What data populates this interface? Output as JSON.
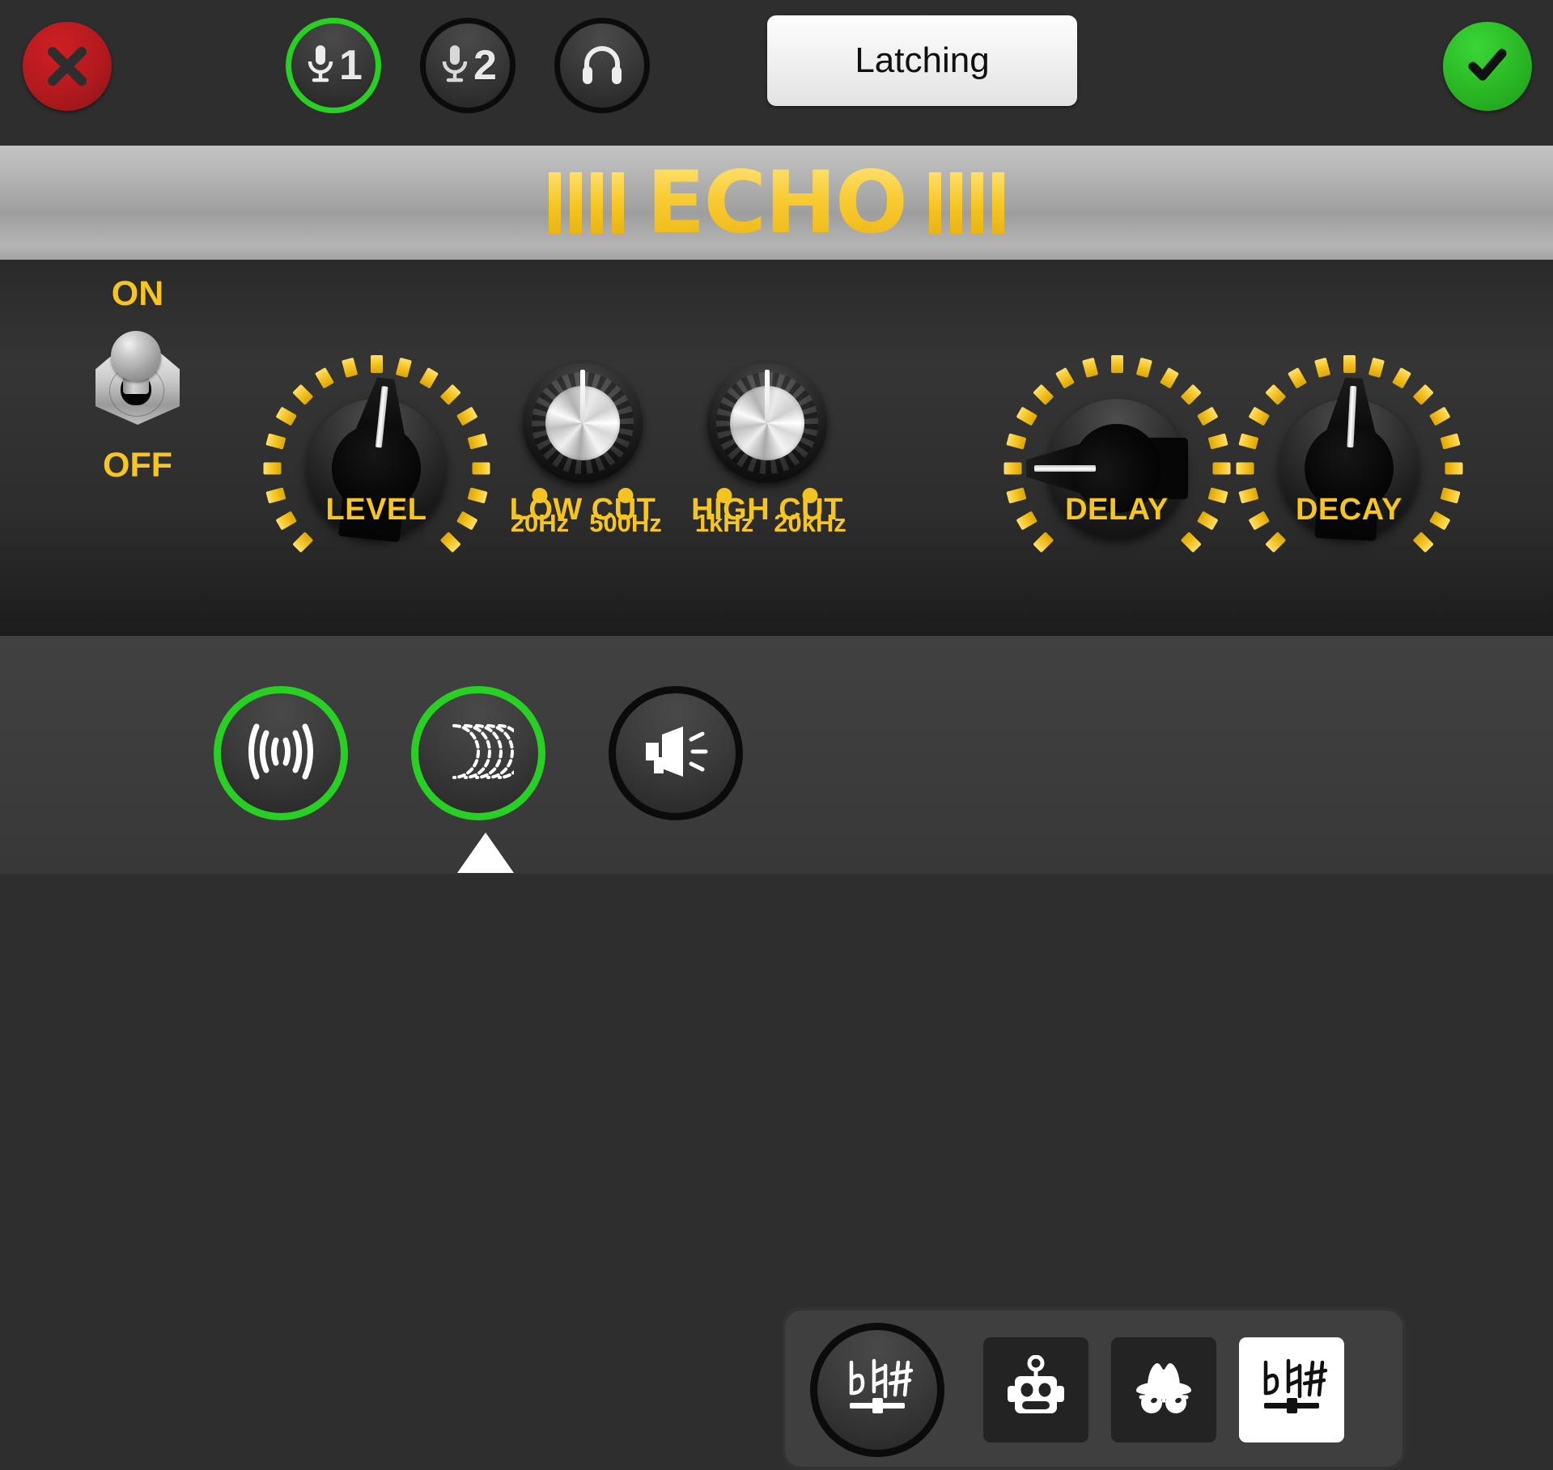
{
  "app": {
    "effect_name": "ECHO"
  },
  "topbar": {
    "close": {
      "icon": "close-x-icon",
      "label": "Close"
    },
    "channels": [
      {
        "icon": "microphone-icon",
        "label": "1",
        "active": true,
        "name": "mic-1"
      },
      {
        "icon": "microphone-icon",
        "label": "2",
        "active": false,
        "name": "mic-2"
      },
      {
        "icon": "headphones-icon",
        "label": "",
        "active": false,
        "name": "headphones"
      }
    ],
    "mode_button": {
      "label": "Latching"
    },
    "confirm": {
      "icon": "checkmark-icon",
      "label": "Confirm"
    }
  },
  "power": {
    "on_label": "ON",
    "off_label": "OFF",
    "state": "ON"
  },
  "knobs": [
    {
      "id": "level",
      "label": "LEVEL",
      "type": "pointer",
      "angle": 6,
      "ticks": 19
    },
    {
      "id": "low_cut",
      "label": "LOW CUT",
      "type": "chrome",
      "angle": 0,
      "markers": [
        {
          "text": "20Hz",
          "pos": -53
        },
        {
          "text": "500Hz",
          "pos": 53
        }
      ]
    },
    {
      "id": "high_cut",
      "label": "HIGH CUT",
      "type": "chrome",
      "angle": 0,
      "markers": [
        {
          "text": "1kHz",
          "pos": -53
        },
        {
          "text": "20kHz",
          "pos": 53
        }
      ]
    },
    {
      "id": "delay",
      "label": "DELAY",
      "type": "pointer",
      "angle": -90,
      "ticks": 19
    },
    {
      "id": "decay",
      "label": "DECAY",
      "type": "pointer",
      "angle": 3,
      "ticks": 19
    }
  ],
  "bottombar": {
    "effects": [
      {
        "id": "reverb",
        "icon": "sound-waves-icon",
        "active": true,
        "selected": false
      },
      {
        "id": "echo",
        "icon": "echo-arcs-icon",
        "active": true,
        "selected": true
      },
      {
        "id": "megaphone",
        "icon": "megaphone-icon",
        "active": false,
        "selected": false
      }
    ],
    "voice_group": {
      "main": {
        "id": "pitch",
        "icon": "pitch-shift-icon"
      },
      "presets": [
        {
          "id": "robot",
          "icon": "robot-head-icon",
          "selected": false
        },
        {
          "id": "incognito",
          "icon": "incognito-hat-icon",
          "selected": false
        },
        {
          "id": "pitch_alt",
          "icon": "pitch-shift-icon",
          "selected": true
        }
      ]
    }
  },
  "colors": {
    "accent_yellow": "#f6c521",
    "active_green": "#27d023",
    "close_red": "#b11a1e",
    "panel_dark": "#2e2e2e",
    "banner_silver": "#b7b7b7"
  }
}
